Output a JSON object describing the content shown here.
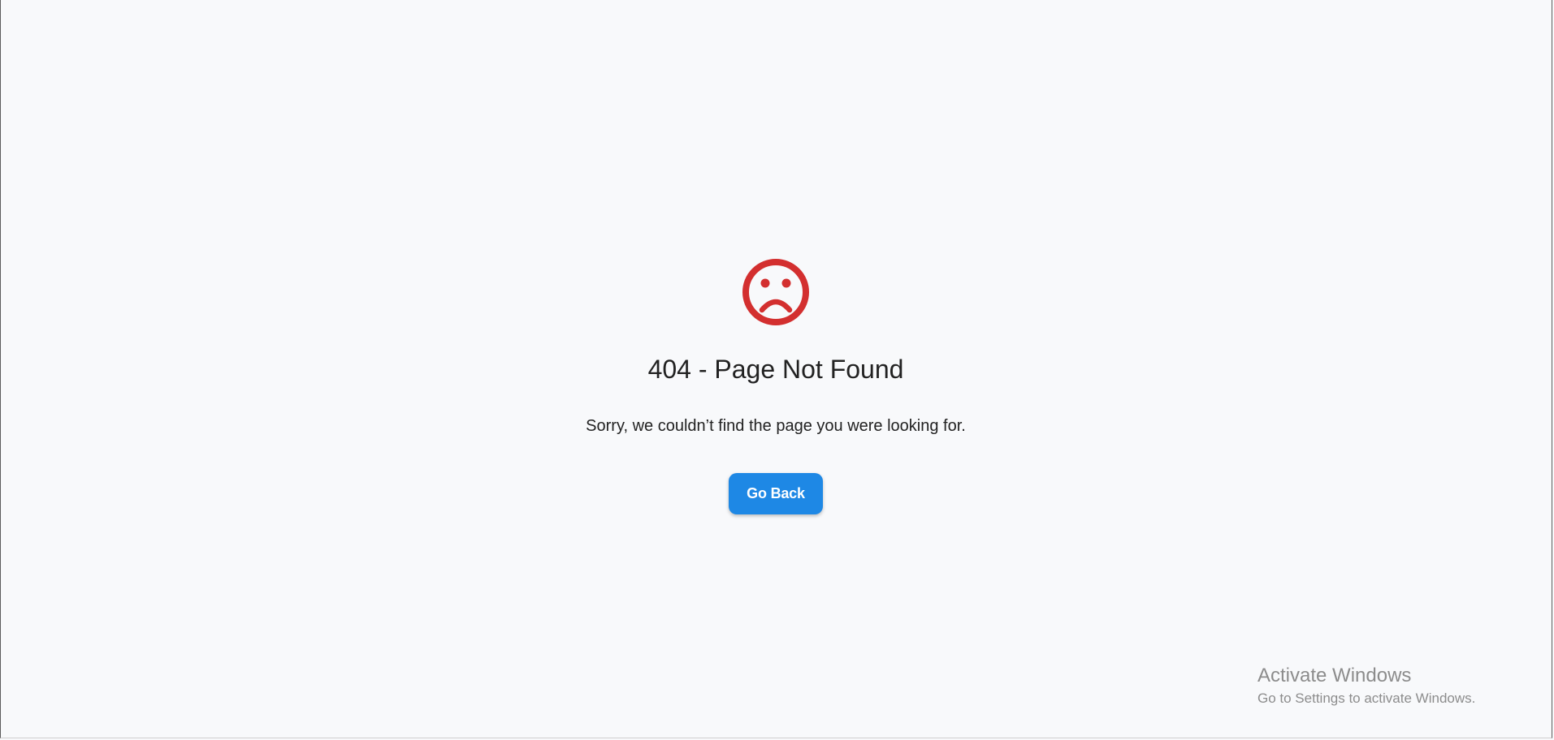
{
  "error_page": {
    "icon": "sad-face-icon",
    "title": "404 - Page Not Found",
    "message": "Sorry, we couldn’t find the page you were looking for.",
    "back_label": "Go Back"
  },
  "watermark": {
    "title": "Activate Windows",
    "subtitle": "Go to Settings to activate Windows."
  },
  "colors": {
    "background": "#f8f9fb",
    "icon": "#d32f2f",
    "button": "#1e88e5",
    "text": "#222222",
    "watermark": "#8c8c8c"
  }
}
